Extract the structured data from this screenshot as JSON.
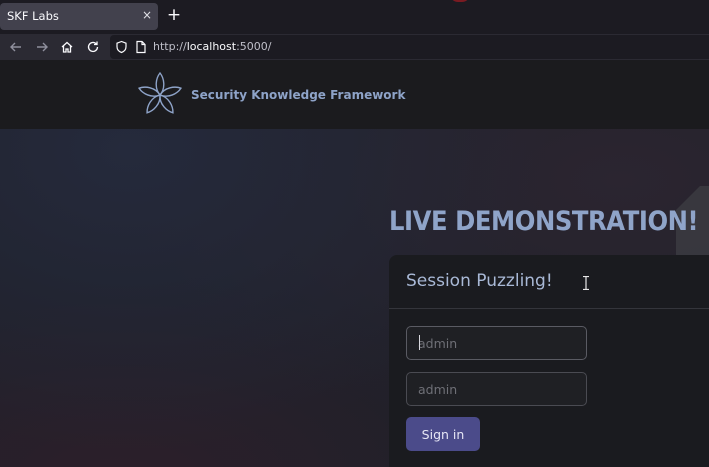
{
  "browser": {
    "tab_title": "SKF Labs",
    "tab_close_glyph": "×",
    "new_tab_glyph": "+",
    "url_prefix": "http://",
    "url_host": "localhost",
    "url_rest": ":5000/",
    "icons": [
      "back-icon",
      "forward-icon",
      "home-icon",
      "reload-icon",
      "shield-icon",
      "page-icon"
    ]
  },
  "header": {
    "brand": "Security Knowledge Framework",
    "logo_icon": "flower-logo-icon"
  },
  "main": {
    "headline": "LIVE DEMONSTRATION!",
    "card_title": "Session Puzzling!",
    "username_placeholder": "admin",
    "password_placeholder": "admin",
    "signin_label": "Sign in"
  },
  "colors": {
    "accent": "#4b4b8a",
    "headline": "#8fa4c9",
    "brand": "#8ea3c8"
  }
}
